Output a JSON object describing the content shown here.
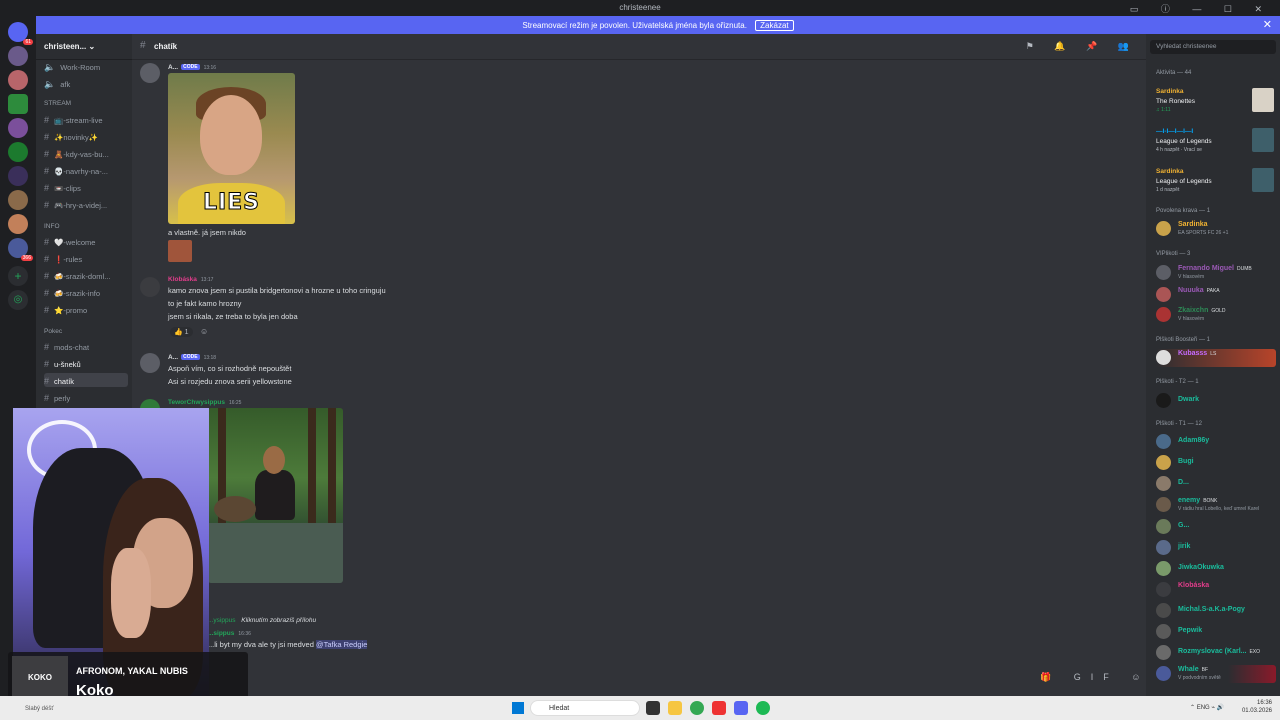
{
  "window": {
    "title": "christeenee"
  },
  "streambar": {
    "message": "Streamovací režim je povolen. Uživatelská jména byla ořiznuta.",
    "disable_label": "Zakázat"
  },
  "servers": {
    "badge1": "61",
    "badge2": "366"
  },
  "server": {
    "name": "christeen..."
  },
  "channels": {
    "top": [
      "Work-Room",
      "afk"
    ],
    "cat_stream": "STREAM",
    "stream": [
      "📺-stream-live",
      "✨novinky✨",
      "🧸-kdy-vas-bu...",
      "💀-navrhy-na-...",
      "📼-clips",
      "🎮-hry-a-videj..."
    ],
    "cat_info": "INFO",
    "info": [
      "🤍-welcome",
      "❗-rules",
      "🍻-srazik-doml...",
      "🍻-srazik-info",
      "⭐-promo"
    ],
    "cat_pokec": "Pokec",
    "pokec": [
      "mods-chat",
      "u-šneků",
      "chatík",
      "perly"
    ]
  },
  "chat": {
    "channel_name": "chatík",
    "messages": {
      "m1_user": "A...",
      "m1_tag": "CODE",
      "m1_time": "13:16",
      "gif_caption": "LIES",
      "m1_line": "a vlastně. já jsem nikdo",
      "m2_user": "Klobáska",
      "m2_time": "13:17",
      "m2_lines": [
        "kamo znova jsem si pustila bridgertonovi a hrozne u toho cringuju",
        "to je fakt kamo hrozny",
        "jsem si rikala, ze treba to byla jen doba"
      ],
      "m2_reaction": "1",
      "m3_user": "A...",
      "m3_tag": "CODE",
      "m3_time": "13:18",
      "m3_lines": [
        "Aspoň vím, co si rozhodně nepouštět",
        "Asi si rozjedu znova serii yellowstone"
      ],
      "m4_user": "TeworChwysippus",
      "m4_time": "16:25",
      "m5_user_partial": "...ysippus",
      "m5_click": "Kliknutím zobrazíš přílohu",
      "m6_user_partial": "...sippus",
      "m6_time": "16:36",
      "m6_line": "...li byt my dva ale ty jsi medved",
      "m6_mention": "@Tafka Redgie"
    }
  },
  "now_playing": {
    "cover_text": "KOKO",
    "artist": "AFRONOM, YAKAL NUBIS",
    "song": "Koko"
  },
  "members": {
    "search_placeholder": "Vyhledat christeenee",
    "activity_header": "Aktivita — 44",
    "activities": [
      {
        "name": "Sardinka",
        "title": "The Ronettes",
        "sub": "♫ 1:11"
      },
      {
        "name": "—I-I—I—I—I",
        "title": "League of Legends",
        "sub": "4 h nazpět · Vrací se"
      },
      {
        "name": "Sardinka",
        "title": "League of Legends",
        "sub": "1 d nazpět"
      }
    ],
    "grp_povolena": "Povolena krava — 1",
    "m_sardinka": "Sardinka",
    "m_sardinka_st": "EA SPORTS FC 26 +1",
    "grp_vip": "VIPlikoti — 3",
    "vip": [
      {
        "name": "Fernando Miguel",
        "badge": "DUMB",
        "st": "V hlasovém"
      },
      {
        "name": "Nuuuka",
        "badge": "PAKA",
        "st": ""
      },
      {
        "name": "Zkaixchn",
        "badge": "GOLD",
        "st": "V hlasovém"
      }
    ],
    "grp_boosteri": "Plškoti Boosteři — 1",
    "m_kubasss": "Kubasss",
    "m_kubasss_badge": "LS",
    "grp_t2": "Plškoti - T2 — 1",
    "m_dwark": "Dwark",
    "grp_t1": "Plškoti - T1 — 12",
    "t1": [
      {
        "name": "Adam86y",
        "badge": "",
        "st": ""
      },
      {
        "name": "Bugi",
        "badge": "",
        "st": ""
      },
      {
        "name": "D...",
        "badge": "",
        "st": ""
      },
      {
        "name": "enemy",
        "badge": "BONK",
        "st": "V rádiu hral Lobello, keď umrel Karel"
      },
      {
        "name": "G...",
        "badge": "",
        "st": ""
      },
      {
        "name": "jirik",
        "badge": "",
        "st": ""
      },
      {
        "name": "JiwkaOkuwka",
        "badge": "",
        "st": ""
      },
      {
        "name": "Klobáska",
        "badge": "",
        "st": ""
      },
      {
        "name": "Michal.S-a.K.a-Pogy",
        "badge": "",
        "st": ""
      },
      {
        "name": "Pepwik",
        "badge": "",
        "st": ""
      },
      {
        "name": "Rozmyslovac (Karl...",
        "badge": "EXO",
        "st": ""
      },
      {
        "name": "Whale",
        "badge": "BF",
        "st": "V podvodním světě"
      }
    ]
  },
  "taskbar": {
    "search_placeholder": "Hledat",
    "lang": "ENG",
    "time": "16:36",
    "date": "01.03.2026",
    "weather": "Slabý déšť"
  }
}
